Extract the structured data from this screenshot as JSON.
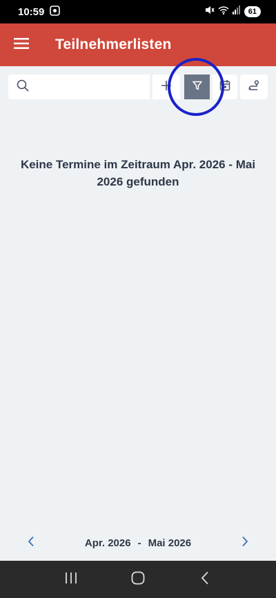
{
  "status_bar": {
    "time": "10:59",
    "battery": "61"
  },
  "app_bar": {
    "title": "Teilnehmerlisten",
    "menu_icon": "hamburger-menu-icon"
  },
  "toolbar": {
    "search_placeholder": "",
    "search_value": "",
    "buttons": [
      "add-icon",
      "filter-icon",
      "calendar-icon",
      "route-icon"
    ],
    "filter_active_color": "#6a7487"
  },
  "main": {
    "empty_message": "Keine Termine im Zeitraum Apr. 2026 - Mai 2026 gefunden"
  },
  "date_range": {
    "start": "Apr. 2026",
    "separator": "-",
    "end": "Mai 2026"
  },
  "colors": {
    "app_bar": "#d0473b",
    "highlight": "#1a22c9",
    "background": "#eff2f4",
    "arrow": "#3d6fb0"
  }
}
